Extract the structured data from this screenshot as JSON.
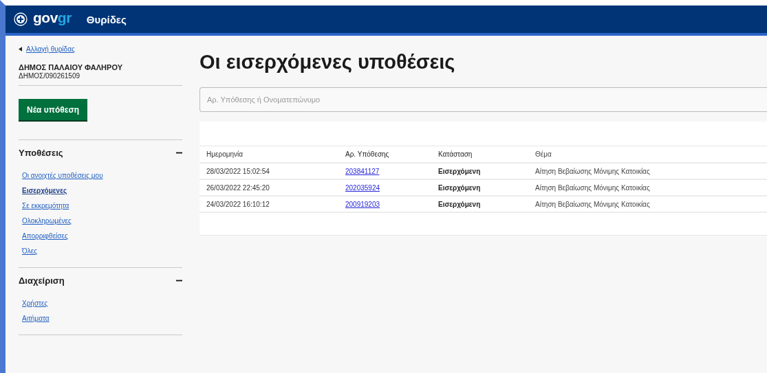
{
  "header": {
    "logo": "gov",
    "logo_accent": "gr",
    "title": "Θυρίδες"
  },
  "sidebar": {
    "back_link": "Αλλαγή θυρίδας",
    "org_name": "ΔΗΜΟΣ ΠΑΛΑΙΟΥ ΦΑΛΗΡΟΥ",
    "org_code": "ΔΗΜΟΣ/090261509",
    "new_button": "Νέα υπόθεση",
    "sections": [
      {
        "title": "Υποθέσεις",
        "expanded": true,
        "items": [
          {
            "label": "Οι ανοιχτές υποθέσεις μου",
            "selected": false
          },
          {
            "label": "Εισερχόμενες",
            "selected": true
          },
          {
            "label": "Σε εκκρεμότητα",
            "selected": false
          },
          {
            "label": "Ολοκληρωμένες",
            "selected": false
          },
          {
            "label": "Απορριφθείσες",
            "selected": false
          },
          {
            "label": "Όλες",
            "selected": false
          }
        ]
      },
      {
        "title": "Διαχείριση",
        "expanded": true,
        "items": [
          {
            "label": "Χρήστες",
            "selected": false
          },
          {
            "label": "Αιτήματα",
            "selected": false
          }
        ]
      }
    ]
  },
  "main": {
    "title": "Οι εισερχόμενες υποθέσεις",
    "search": {
      "placeholder": "Αρ. Υπόθεσης ή Ονοματεπώνυμο"
    },
    "table": {
      "columns": [
        "Ημερομηνία",
        "Αρ. Υπόθεσης",
        "Κατάσταση",
        "Θέμα"
      ],
      "rows": [
        {
          "date": "28/03/2022 15:02:54",
          "case_no": "203841127",
          "status": "Εισερχόμενη",
          "subject": "Αίτηση Βεβαίωσης Μόνιμης Κατοικίας"
        },
        {
          "date": "26/03/2022 22:45:20",
          "case_no": "202035924",
          "status": "Εισερχόμενη",
          "subject": "Αίτηση Βεβαίωσης Μόνιμης Κατοικίας"
        },
        {
          "date": "24/03/2022 16:10:12",
          "case_no": "200919203",
          "status": "Εισερχόμενη",
          "subject": "Αίτηση Βεβαίωσης Μόνιμης Κατοικίας"
        }
      ]
    }
  }
}
